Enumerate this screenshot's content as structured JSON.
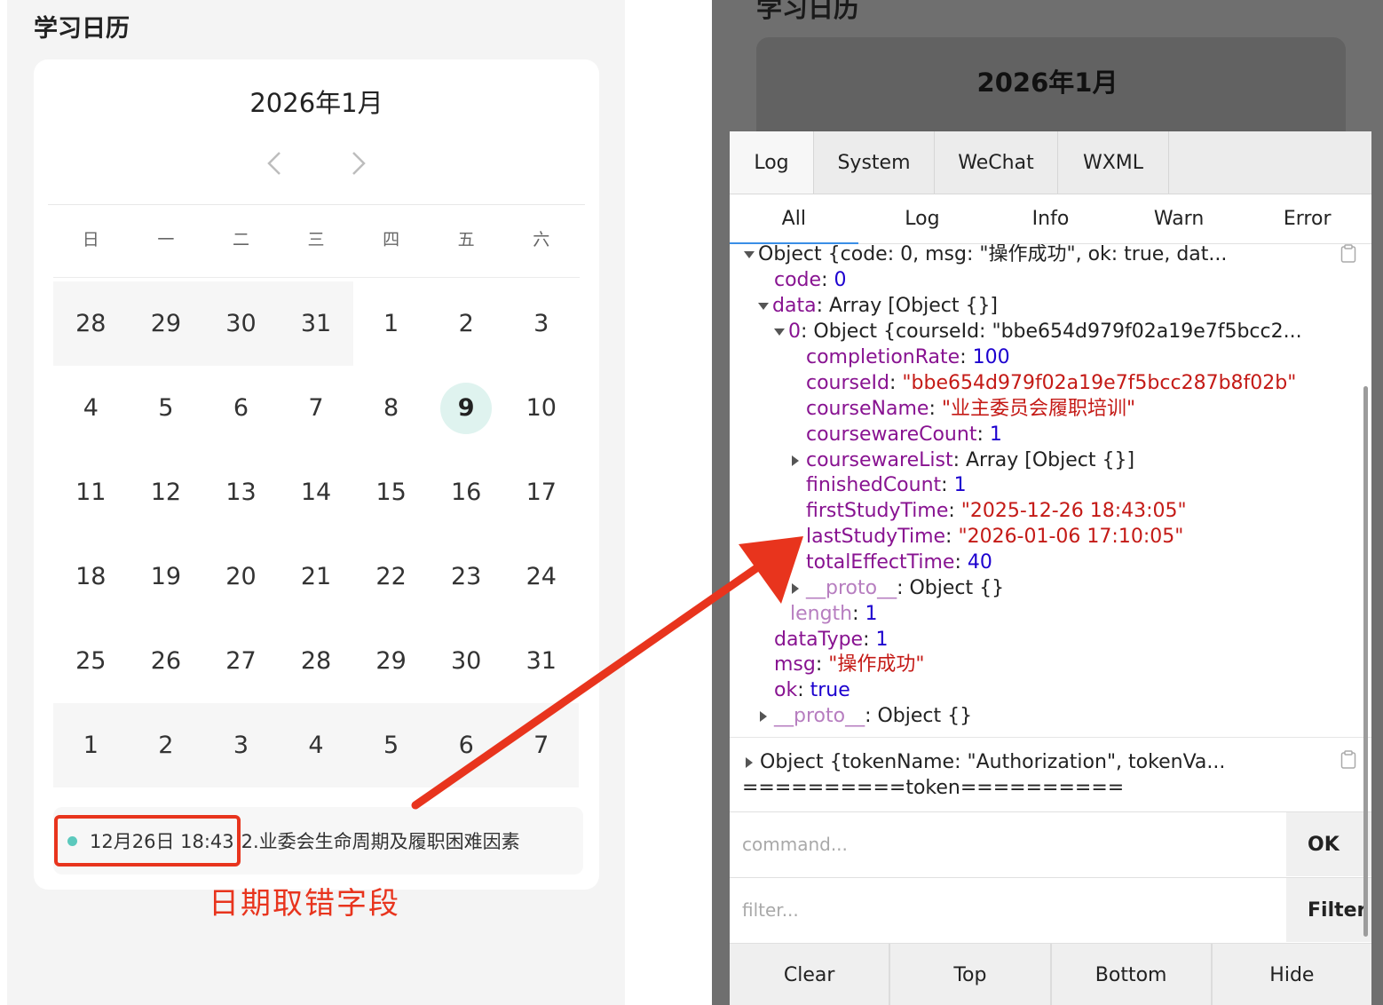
{
  "left": {
    "page_title": "学习日历",
    "calendar": {
      "month_title": "2026年1月",
      "prev_icon": "chevron-left-icon",
      "next_icon": "chevron-right-icon",
      "weekdays": [
        "日",
        "一",
        "二",
        "三",
        "四",
        "五",
        "六"
      ],
      "weeks": [
        [
          "28",
          "29",
          "30",
          "31",
          "1",
          "2",
          "3"
        ],
        [
          "4",
          "5",
          "6",
          "7",
          "8",
          "9",
          "10"
        ],
        [
          "11",
          "12",
          "13",
          "14",
          "15",
          "16",
          "17"
        ],
        [
          "18",
          "19",
          "20",
          "21",
          "22",
          "23",
          "24"
        ],
        [
          "25",
          "26",
          "27",
          "28",
          "29",
          "30",
          "31"
        ],
        [
          "1",
          "2",
          "3",
          "4",
          "5",
          "6",
          "7"
        ]
      ],
      "today": "9",
      "today_color": "#dff3ef"
    },
    "record": {
      "date": "12月26日 18:43",
      "title": "2.业委会生命周期及履职困难因素",
      "dot_color": "#5cc9bd"
    },
    "annotation": "日期取错字段",
    "annotation_color": "#e8341d"
  },
  "right": {
    "partial_title": "学习日历",
    "month_title": "2026年1月",
    "top_tabs": [
      "Log",
      "System",
      "WeChat",
      "WXML"
    ],
    "level_tabs": [
      "All",
      "Log",
      "Info",
      "Warn",
      "Error"
    ],
    "log": {
      "obj_summary": "Object {code: 0, msg: \"操作成功\", ok: true, dat...",
      "code_key": "code",
      "code_val": "0",
      "data_key": "data",
      "data_val": "Array [Object {}]",
      "item0_key": "0",
      "item0_val": "Object {courseId: \"bbe654d979f02a19e7f5bcc2...",
      "completionRate_key": "completionRate",
      "completionRate_val": "100",
      "courseId_key": "courseId",
      "courseId_val": "\"bbe654d979f02a19e7f5bcc287b8f02b\"",
      "courseName_key": "courseName",
      "courseName_val": "\"业主委员会履职培训\"",
      "coursewareCount_key": "coursewareCount",
      "coursewareCount_val": "1",
      "coursewareList_key": "coursewareList",
      "coursewareList_val": "Array [Object {}]",
      "finishedCount_key": "finishedCount",
      "finishedCount_val": "1",
      "firstStudyTime_key": "firstStudyTime",
      "firstStudyTime_val": "\"2025-12-26 18:43:05\"",
      "lastStudyTime_key": "lastStudyTime",
      "lastStudyTime_val": "\"2026-01-06 17:10:05\"",
      "totalEffectTime_key": "totalEffectTime",
      "totalEffectTime_val": "40",
      "proto_key": "__proto__",
      "proto_val": "Object {}",
      "length_key": "length",
      "length_val": "1",
      "dataType_key": "dataType",
      "dataType_val": "1",
      "msg_key": "msg",
      "msg_val": "\"操作成功\"",
      "ok_key": "ok",
      "ok_val": "true",
      "proto2_key": "__proto__",
      "proto2_val": "Object {}",
      "token_summary": "Object {tokenName: \"Authorization\", tokenVa...",
      "token_line": "==========token=========="
    },
    "command_placeholder": "command...",
    "ok_label": "OK",
    "filter_placeholder": "filter...",
    "filter_label": "Filter",
    "bottom_buttons": [
      "Clear",
      "Top",
      "Bottom",
      "Hide"
    ]
  }
}
